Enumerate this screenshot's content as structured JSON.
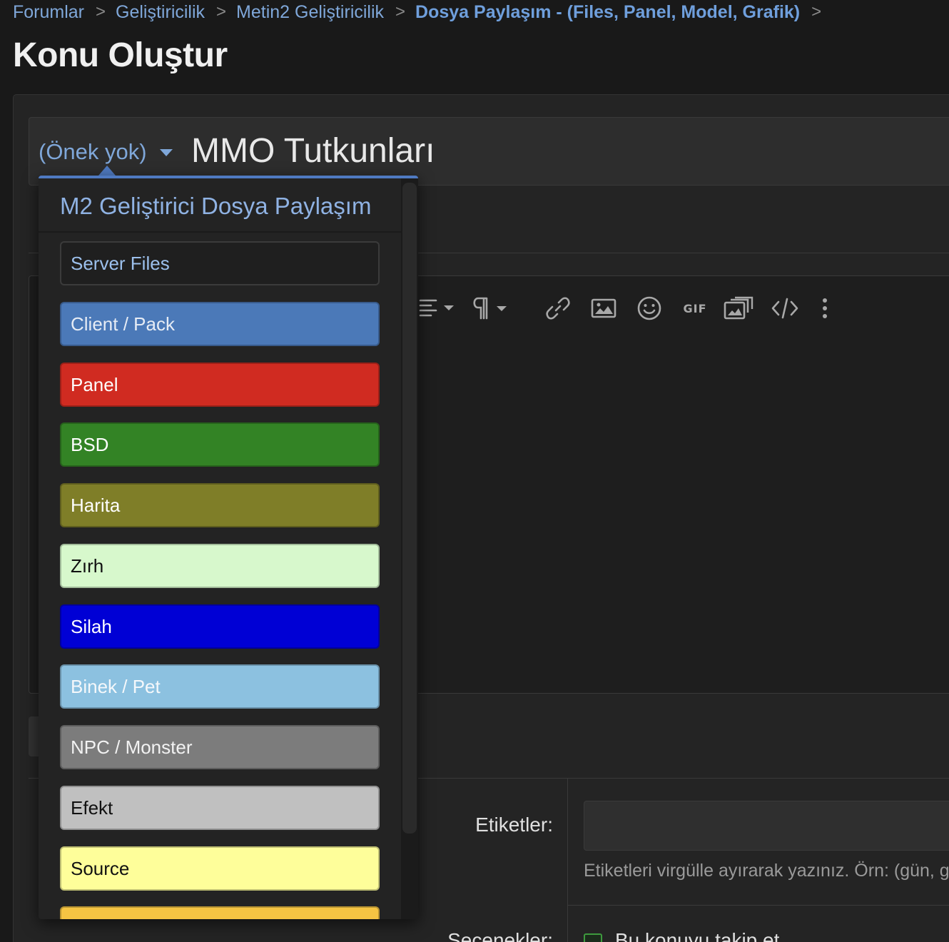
{
  "breadcrumb": {
    "items": [
      "Forumlar",
      "Geliştiricilik",
      "Metin2 Geliştiricilik",
      "Dosya Paylaşım - (Files, Panel, Model, Grafik)"
    ],
    "separator": ">"
  },
  "page_title": "Konu Oluştur",
  "title_row": {
    "prefix_label": "(Önek yok)",
    "title_value": "MMO Tutkunları"
  },
  "prefix_menu": {
    "group_title": "M2 Geliştirici Dosya Paylaşım",
    "items": [
      {
        "label": "Server Files",
        "bg": "#1f1f1f",
        "fg": "#9cc0ec"
      },
      {
        "label": "Client / Pack",
        "bg": "#4b79b8",
        "fg": "#e6ecf5"
      },
      {
        "label": "Panel",
        "bg": "#d02b21",
        "fg": "#ffffff"
      },
      {
        "label": "BSD",
        "bg": "#338325",
        "fg": "#ffffff"
      },
      {
        "label": "Harita",
        "bg": "#7f7e28",
        "fg": "#ffffff"
      },
      {
        "label": "Zırh",
        "bg": "#d7f8cc",
        "fg": "#111111"
      },
      {
        "label": "Silah",
        "bg": "#0000d5",
        "fg": "#ffffff"
      },
      {
        "label": "Binek / Pet",
        "bg": "#8cc1e0",
        "fg": "#f5f8fb"
      },
      {
        "label": "NPC / Monster",
        "bg": "#7c7c7c",
        "fg": "#f2f2f2"
      },
      {
        "label": "Efekt",
        "bg": "#c0c0c0",
        "fg": "#111111"
      },
      {
        "label": "Source",
        "bg": "#fefe9a",
        "fg": "#111111"
      },
      {
        "label": "",
        "bg": "#f5c443",
        "fg": "#111111"
      }
    ]
  },
  "toolbar": {
    "icons": [
      "align-icon",
      "paragraph-icon",
      "link-icon",
      "image-icon",
      "smiley-icon",
      "gif-icon",
      "media-gallery-icon",
      "code-icon",
      "more-options-icon"
    ],
    "gif_label": "GIF"
  },
  "tags": {
    "label": "Etiketler:",
    "hint": "Etiketleri virgülle ayırarak yazınız. Örn: (gün, g"
  },
  "options": {
    "label": "Seçenekler:",
    "follow_label": "Bu konuyu takip et"
  }
}
